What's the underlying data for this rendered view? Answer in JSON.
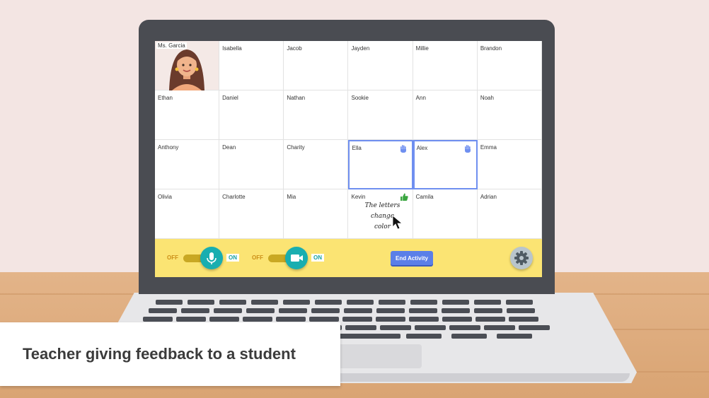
{
  "roster": [
    {
      "name": "Ms. Garcia",
      "teacher": true
    },
    {
      "name": "Isabella"
    },
    {
      "name": "Jacob"
    },
    {
      "name": "Jayden"
    },
    {
      "name": "Millie"
    },
    {
      "name": "Brandon"
    },
    {
      "name": "Ethan"
    },
    {
      "name": "Daniel"
    },
    {
      "name": "Nathan"
    },
    {
      "name": "Sookie"
    },
    {
      "name": "Ann"
    },
    {
      "name": "Noah"
    },
    {
      "name": "Anthony"
    },
    {
      "name": "Dean"
    },
    {
      "name": "Charity"
    },
    {
      "name": "Ella",
      "hand_raised": true
    },
    {
      "name": "Alex",
      "hand_raised": true
    },
    {
      "name": "Emma"
    },
    {
      "name": "Olivia"
    },
    {
      "name": "Charlotte"
    },
    {
      "name": "Mia"
    },
    {
      "name": "Kevin",
      "thumbs_up": true
    },
    {
      "name": "Camila"
    },
    {
      "name": "Adrian"
    }
  ],
  "feedback_note": [
    "The letters",
    "change",
    "color"
  ],
  "toolbar": {
    "mic": {
      "off_label": "OFF",
      "on_label": "ON",
      "icon": "microphone-icon"
    },
    "camera": {
      "off_label": "OFF",
      "on_label": "ON",
      "icon": "video-camera-icon"
    },
    "end_activity_label": "End Activity",
    "settings_icon": "gear-icon"
  },
  "caption": "Teacher giving feedback to a student",
  "colors": {
    "highlight": "#6f8ff0",
    "toolbar": "#fbe473",
    "toggle": "#19aeb0",
    "end_button": "#5b7fe8",
    "thumbs_up": "#3aa640"
  }
}
